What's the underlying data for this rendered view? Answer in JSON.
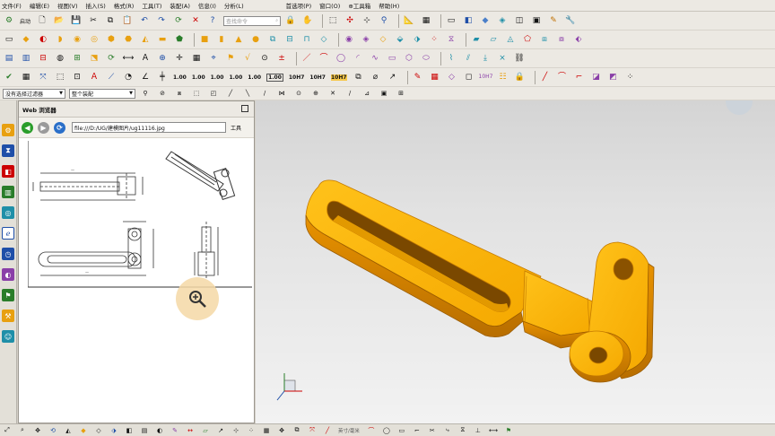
{
  "menu": {
    "items": [
      "文件(F)",
      "编辑(E)",
      "视图(V)",
      "插入(S)",
      "格式(R)",
      "工具(T)",
      "装配(A)",
      "信息(I)",
      "分析(L)"
    ],
    "items_right": [
      "首选项(P)",
      "窗口(O)",
      "⊕工具箱",
      "帮助(H)"
    ]
  },
  "toolbar1": {
    "start_label": "启动",
    "search_placeholder": "查找命令"
  },
  "toolbar3": {
    "dim_labels": [
      "1.00",
      "1.00",
      "1.00",
      "1.00",
      "1.00",
      "1.00",
      "10H7",
      "10H7",
      "10H7",
      "10H7"
    ]
  },
  "selection_bar": {
    "filter_value": "没有选择过滤器",
    "scope_value": "整个装配"
  },
  "web_panel": {
    "title": "Web 浏览器",
    "address": "file:///D:/UG/建模图片/ug11116.jpg",
    "tools_label": "工具"
  },
  "statusbar": {
    "text": "英寸/毫米"
  },
  "colors": {
    "model_orange": "#f5a800",
    "model_dark": "#c47a00",
    "ui_background": "#ece9e3",
    "viewport_top": "#d4d4d4",
    "viewport_bottom": "#f2f2f2"
  }
}
